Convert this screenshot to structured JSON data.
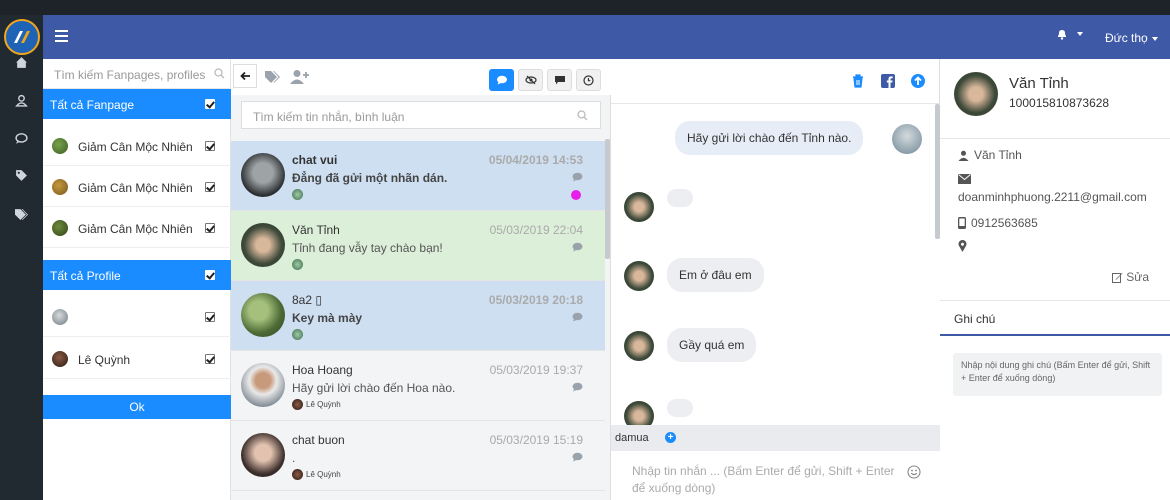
{
  "header": {
    "user_name": "Đức thọ",
    "bell_icon": "bell-icon",
    "menu_icon": "hamburger-icon"
  },
  "sidebar_icons": [
    "home-icon",
    "user-icon",
    "chat-icon",
    "tag-icon",
    "tags-icon"
  ],
  "filter": {
    "search_placeholder": "Tìm kiếm Fanpages, profiles",
    "fanpage_header": "Tất cả Fanpage",
    "fanpages": [
      {
        "name": "Giảm Cân Mộc Nhiên"
      },
      {
        "name": "Giảm Cân Mộc Nhiên"
      },
      {
        "name": "Giảm Cân Mộc Nhiên"
      }
    ],
    "profile_header": "Tất cả Profile",
    "profiles": [
      {
        "name": ""
      },
      {
        "name": "Lê Quỳnh"
      }
    ],
    "ok_label": "Ok"
  },
  "conversations": {
    "search_placeholder": "Tìm kiếm tin nhắn, bình luận",
    "items": [
      {
        "name": "chat vui",
        "time": "05/04/2019 14:53",
        "message": "Đẳng đã gửi một nhãn dán.",
        "sub": "",
        "unread": true
      },
      {
        "name": "Văn Tỉnh",
        "time": "05/03/2019 22:04",
        "message": "Tỉnh đang vẫy tay chào bạn!",
        "sub": "",
        "unread": false
      },
      {
        "name": "8a2 ▯",
        "time": "05/03/2019 20:18",
        "message": "Key mà mày",
        "sub": "",
        "unread": true
      },
      {
        "name": "Hoa Hoang",
        "time": "05/03/2019 19:37",
        "message": "Hãy gửi lời chào đến Hoa nào.",
        "sub": "Lê Quỳnh",
        "unread": false
      },
      {
        "name": "chat buon",
        "time": "05/03/2019 15:19",
        "message": ".",
        "sub": "Lê Quỳnh",
        "unread": false
      }
    ]
  },
  "chat": {
    "messages": [
      {
        "text": "Hãy gửi lời chào đến Tỉnh nào.",
        "dir": "out"
      },
      {
        "text": "",
        "dir": "in"
      },
      {
        "text": "Em ở đâu em",
        "dir": "in"
      },
      {
        "text": "Gầy quá em",
        "dir": "in"
      },
      {
        "text": "",
        "dir": "in"
      }
    ],
    "tag": "damua",
    "composer_placeholder": "Nhập tin nhắn ... (Bấm Enter để gửi, Shift + Enter để xuống dòng)"
  },
  "profile": {
    "name": "Văn Tỉnh",
    "id": "100015810873628",
    "contact_name": "Văn Tỉnh",
    "email": "doanminhphuong.2211@gmail.com",
    "phone": "0912563685",
    "edit_label": "Sửa",
    "notes_tab": "Ghi chú",
    "notes_placeholder": "Nhập nội dung ghi chú (Bấm Enter để gửi, Shift + Enter để xuống dòng)"
  },
  "colors": {
    "header": "#3e5aa6",
    "accent": "#1a8cff",
    "selected_row": "#cfdff2",
    "greeted_row": "#dcefd9",
    "unread_dot": "#e91ee9"
  }
}
